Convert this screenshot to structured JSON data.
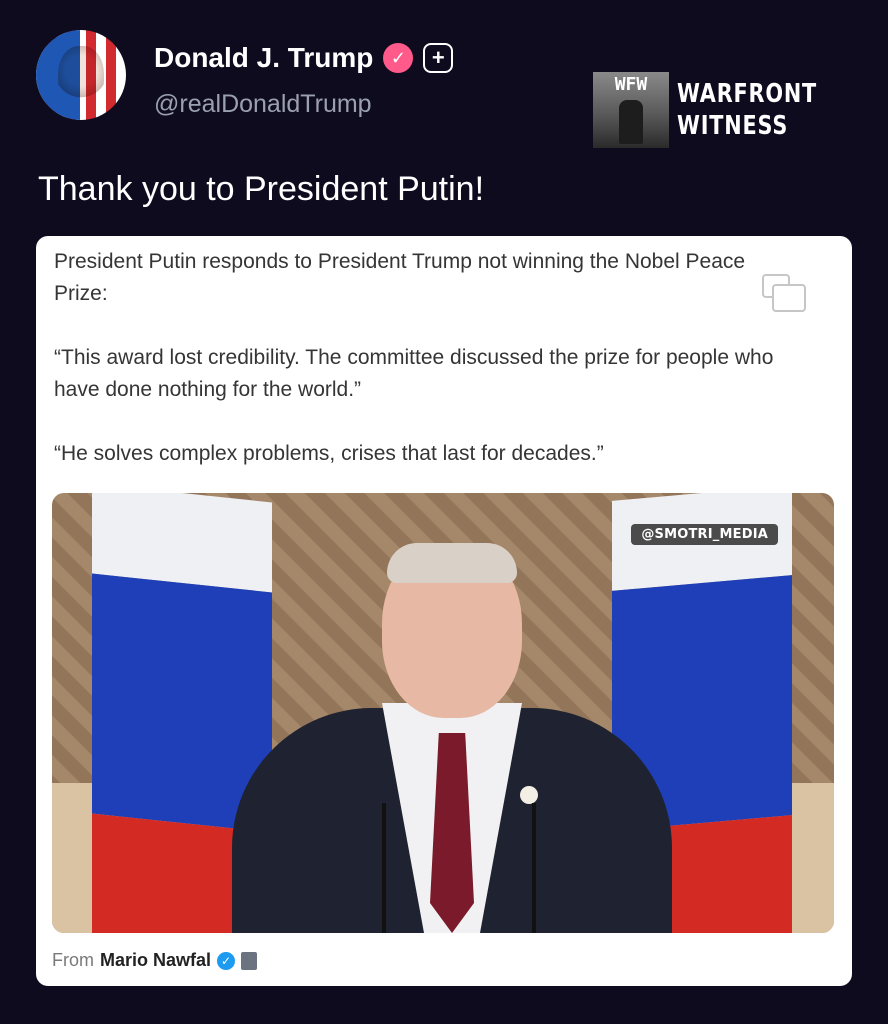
{
  "author": {
    "name": "Donald J. Trump",
    "handle": "@realDonaldTrump",
    "verified_icon": "verified-check-icon",
    "add_icon": "plus-icon"
  },
  "watermark": {
    "logo_text": "WFW",
    "line1": "WARFRONT",
    "line2": "WITNESS"
  },
  "post": {
    "text": "Thank you to President Putin!"
  },
  "quoted": {
    "paragraphs": [
      "President Putin responds to President Trump not winning the Nobel Peace Prize:",
      "“This award lost credibility. The committee discussed the prize for people who have done nothing for the world.”",
      "“He solves complex problems, crises that last for decades.”"
    ],
    "media_badge": "@SMOTRI_MEDIA",
    "from_label": "From",
    "from_author": "Mario Nawfal"
  },
  "colors": {
    "background": "#0e0b1f",
    "verified_pink": "#ff5a8a",
    "verified_blue": "#1d9bf0"
  }
}
